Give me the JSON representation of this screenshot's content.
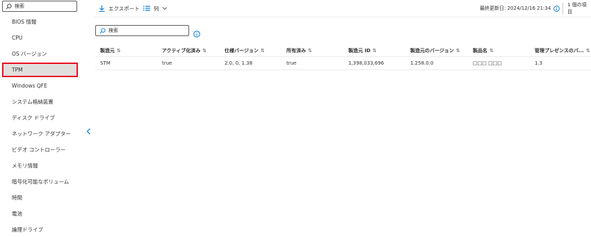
{
  "sidebar": {
    "search_placeholder": "検索",
    "items": [
      {
        "label": "BIOS 情報"
      },
      {
        "label": "CPU"
      },
      {
        "label": "OS バージョン"
      },
      {
        "label": "TPM"
      },
      {
        "label": "Windows QFE"
      },
      {
        "label": "システム格納装置"
      },
      {
        "label": "ディスク ドライブ"
      },
      {
        "label": "ネットワーク アダプター"
      },
      {
        "label": "ビデオ コントローラー"
      },
      {
        "label": "メモリ情報"
      },
      {
        "label": "暗号化可能なボリューム"
      },
      {
        "label": "時間"
      },
      {
        "label": "電池"
      },
      {
        "label": "論理ドライブ"
      }
    ],
    "selected": "TPM"
  },
  "toolbar": {
    "export_label": "エクスポート",
    "columns_label": "列",
    "last_updated": "最終更新日: 2024/12/16 21:34",
    "item_count": "1 個の項目"
  },
  "main": {
    "search_placeholder": "検索"
  },
  "table": {
    "headers": [
      "製造元",
      "アクティブ化済み",
      "仕様バージョン",
      "所有済み",
      "製造元 ID",
      "製造元のバージョン",
      "製品名",
      "管理プレゼンスのバ..."
    ],
    "rows": [
      [
        "STM",
        "true",
        "2.0, 0, 1.38",
        "true",
        "1,398,033,696",
        "1.258.0.0",
        "□□□ □□□",
        "1.3"
      ]
    ]
  },
  "colors": {
    "selected_border": "#e81123",
    "selected_bg": "#e1dfdd",
    "accent": "#0078d4"
  }
}
